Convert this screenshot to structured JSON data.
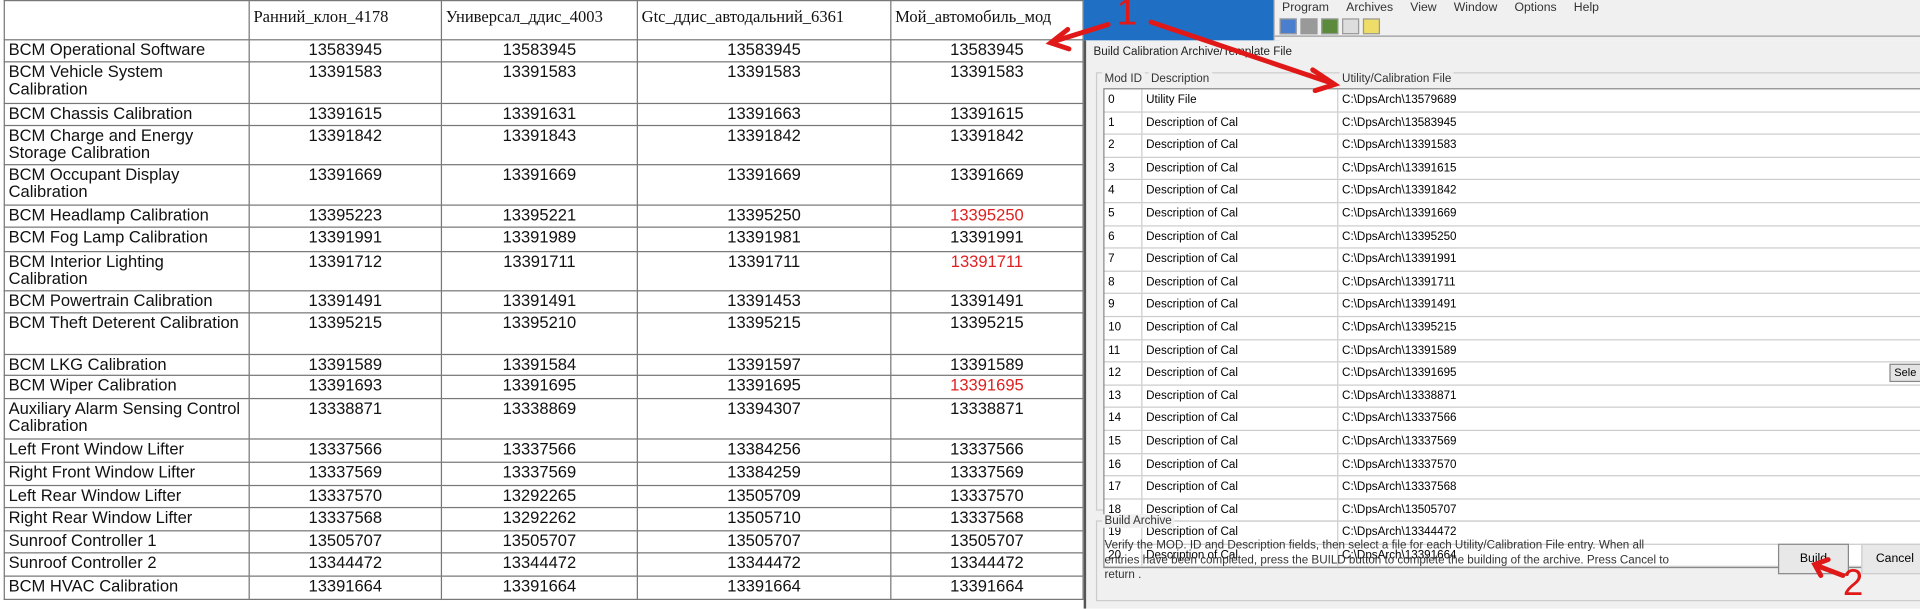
{
  "table": {
    "headers": [
      "",
      "Ранний_клон_4178",
      "Универсал_ддис_4003",
      "Gtc_ддис_автодальний_6361",
      "Мой_автомобиль_мод"
    ],
    "rows": [
      {
        "name": "BCM Operational Software",
        "values": [
          "13583945",
          "13583945",
          "13583945",
          "13583945"
        ]
      },
      {
        "name": "BCM Vehicle System Calibration",
        "values": [
          "13391583",
          "13391583",
          "13391583",
          "13391583"
        ]
      },
      {
        "name": "BCM Chassis Calibration",
        "values": [
          "13391615",
          "13391631",
          "13391663",
          "13391615"
        ]
      },
      {
        "name": "BCM Charge and Energy Storage Calibration",
        "values": [
          "13391842",
          "13391843",
          "13391842",
          "13391842"
        ]
      },
      {
        "name": "BCM Occupant Display Calibration",
        "values": [
          "13391669",
          "13391669",
          "13391669",
          "13391669"
        ]
      },
      {
        "name": "BCM Headlamp Calibration",
        "values": [
          "13395223",
          "13395221",
          "13395250",
          "13395250"
        ],
        "highlight": true
      },
      {
        "name": "BCM Fog Lamp Calibration",
        "values": [
          "13391991",
          "13391989",
          "13391981",
          "13391991"
        ]
      },
      {
        "name": "BCM Interior Lighting Calibration",
        "values": [
          "13391712",
          "13391711",
          "13391711",
          "13391711"
        ],
        "highlight": true
      },
      {
        "name": "BCM Powertrain Calibration",
        "values": [
          "13391491",
          "13391491",
          "13391453",
          "13391491"
        ]
      },
      {
        "name": "BCM Theft Deterent Calibration",
        "values": [
          "13395215",
          "13395210",
          "13395215",
          "13395215"
        ]
      },
      {
        "name": "BCM LKG Calibration",
        "values": [
          "13391589",
          "13391584",
          "13391597",
          "13391589"
        ]
      },
      {
        "name": "BCM Wiper Calibration",
        "values": [
          "13391693",
          "13391695",
          "13391695",
          "13391695"
        ],
        "highlight": true
      },
      {
        "name": "Auxiliary Alarm Sensing Control Calibration",
        "values": [
          "13338871",
          "13338869",
          "13394307",
          "13338871"
        ]
      },
      {
        "name": "Left Front Window Lifter",
        "values": [
          "13337566",
          "13337566",
          "13384256",
          "13337566"
        ]
      },
      {
        "name": "Right Front Window Lifter",
        "values": [
          "13337569",
          "13337569",
          "13384259",
          "13337569"
        ]
      },
      {
        "name": "Left Rear Window Lifter",
        "values": [
          "13337570",
          "13292265",
          "13505709",
          "13337570"
        ]
      },
      {
        "name": "Right Rear Window Lifter",
        "values": [
          "13337568",
          "13292262",
          "13505710",
          "13337568"
        ]
      },
      {
        "name": "Sunroof Controller 1",
        "values": [
          "13505707",
          "13505707",
          "13505707",
          "13505707"
        ]
      },
      {
        "name": "Sunroof Controller 2",
        "values": [
          "13344472",
          "13344472",
          "13344472",
          "13344472"
        ]
      },
      {
        "name": "BCM HVAC Calibration",
        "values": [
          "13391664",
          "13391664",
          "13391664",
          "13391664"
        ]
      }
    ],
    "highlight_color": "#e02020"
  },
  "app": {
    "menu": [
      "Program",
      "Archives",
      "View",
      "Window",
      "Options",
      "Help"
    ]
  },
  "dialog": {
    "title": "Build Calibration  Archive/Template File",
    "col_modid": "Mod ID",
    "col_desc": "Description",
    "col_file": "Utility/Calibration File",
    "select_label": "Sele",
    "rows": [
      {
        "id": "0",
        "desc": "Utility File",
        "file": "C:\\DpsArch\\13579689"
      },
      {
        "id": "1",
        "desc": "Description of Cal",
        "file": "C:\\DpsArch\\13583945"
      },
      {
        "id": "2",
        "desc": "Description of Cal",
        "file": "C:\\DpsArch\\13391583"
      },
      {
        "id": "3",
        "desc": "Description of Cal",
        "file": "C:\\DpsArch\\13391615"
      },
      {
        "id": "4",
        "desc": "Description of Cal",
        "file": "C:\\DpsArch\\13391842"
      },
      {
        "id": "5",
        "desc": "Description of Cal",
        "file": "C:\\DpsArch\\13391669"
      },
      {
        "id": "6",
        "desc": "Description of Cal",
        "file": "C:\\DpsArch\\13395250"
      },
      {
        "id": "7",
        "desc": "Description of Cal",
        "file": "C:\\DpsArch\\13391991"
      },
      {
        "id": "8",
        "desc": "Description of Cal",
        "file": "C:\\DpsArch\\13391711"
      },
      {
        "id": "9",
        "desc": "Description of Cal",
        "file": "C:\\DpsArch\\13391491"
      },
      {
        "id": "10",
        "desc": "Description of Cal",
        "file": "C:\\DpsArch\\13395215"
      },
      {
        "id": "11",
        "desc": "Description of Cal",
        "file": "C:\\DpsArch\\13391589"
      },
      {
        "id": "12",
        "desc": "Description of Cal",
        "file": "C:\\DpsArch\\13391695"
      },
      {
        "id": "13",
        "desc": "Description of Cal",
        "file": "C:\\DpsArch\\13338871"
      },
      {
        "id": "14",
        "desc": "Description of Cal",
        "file": "C:\\DpsArch\\13337566"
      },
      {
        "id": "15",
        "desc": "Description of Cal",
        "file": "C:\\DpsArch\\13337569"
      },
      {
        "id": "16",
        "desc": "Description of Cal",
        "file": "C:\\DpsArch\\13337570"
      },
      {
        "id": "17",
        "desc": "Description of Cal",
        "file": "C:\\DpsArch\\13337568"
      },
      {
        "id": "18",
        "desc": "Description of Cal",
        "file": "C:\\DpsArch\\13505707"
      },
      {
        "id": "19",
        "desc": "Description of Cal",
        "file": "C:\\DpsArch\\13344472"
      },
      {
        "id": "20",
        "desc": "Description of Cal",
        "file": "C:\\DpsArch\\13391664"
      }
    ],
    "build_archive_title": "Build Archive",
    "build_archive_text": "Verify the MOD. ID and Description fields, then select a file for each Utility/Calibration File entry.  When all entries have been completed, press the BUILD button to complete the building of the archive.  Press Cancel to return .",
    "build_label": "Build",
    "cancel_label": "Cancel"
  },
  "annotations": {
    "one": "1",
    "two": "2",
    "color": "#e01818"
  }
}
